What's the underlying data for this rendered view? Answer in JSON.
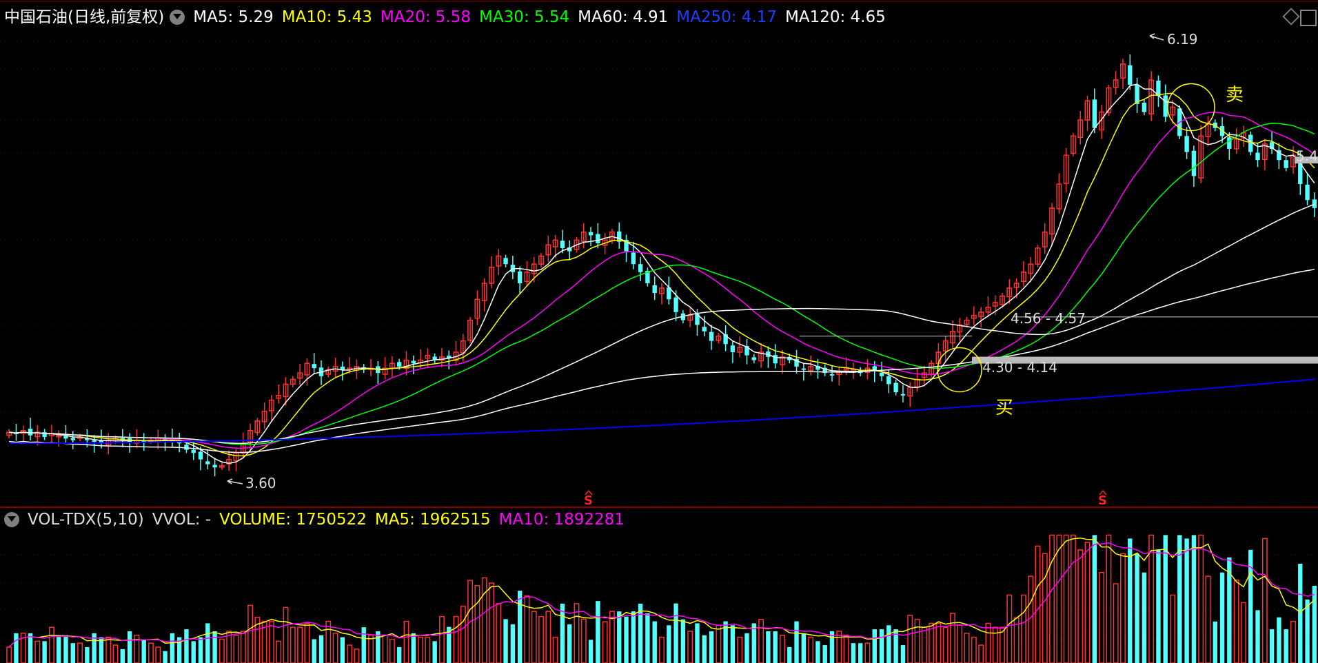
{
  "header": {
    "title": "中国石油(日线,前复权)",
    "ma": [
      {
        "label": "MA5: 5.29",
        "color": "#ffffff"
      },
      {
        "label": "MA10: 5.43",
        "color": "#ffff00"
      },
      {
        "label": "MA20: 5.58",
        "color": "#ff00ff"
      },
      {
        "label": "MA30: 5.54",
        "color": "#00ff00"
      },
      {
        "label": "MA60: 4.91",
        "color": "#ffffff"
      },
      {
        "label": "MA250: 4.17",
        "color": "#0000ff"
      },
      {
        "label": "MA120: 4.65",
        "color": "#ffffff"
      }
    ]
  },
  "volume_header": {
    "title": "VOL-TDX(5,10)",
    "vvol": "VVOL: -",
    "volume": "VOLUME: 1750522",
    "ma5": "MA5: 1962515",
    "ma10": "MA10: 1892281"
  },
  "annotations": {
    "high": "6.19",
    "low": "3.60",
    "buy": "买",
    "sell": "卖",
    "range_upper": "4.56 - 4.57",
    "range_lower": "4.30 - 4.14",
    "right_edge_label": "5.4",
    "s_marker": "S"
  },
  "colors": {
    "up": "#ff3232",
    "down": "#54ffff",
    "ma5": "#ffffff",
    "ma10": "#ffff00",
    "ma20": "#ff00ff",
    "ma30": "#00ff00",
    "ma60": "#ffffff",
    "ma120": "#ffffff",
    "ma250": "#0000ff",
    "grid": "#3a0000"
  },
  "chart_data": {
    "type": "candlestick",
    "title": "中国石油(日线,前复权)",
    "price_ylim": [
      3.45,
      6.3
    ],
    "high": 6.19,
    "low": 3.6,
    "close_series": [
      3.85,
      3.84,
      3.86,
      3.83,
      3.85,
      3.82,
      3.84,
      3.83,
      3.81,
      3.8,
      3.82,
      3.8,
      3.79,
      3.78,
      3.8,
      3.81,
      3.8,
      3.79,
      3.8,
      3.79,
      3.8,
      3.81,
      3.8,
      3.79,
      3.78,
      3.74,
      3.72,
      3.68,
      3.65,
      3.63,
      3.64,
      3.68,
      3.72,
      3.78,
      3.86,
      3.92,
      3.98,
      4.05,
      4.08,
      4.15,
      4.18,
      4.22,
      4.28,
      4.25,
      4.2,
      4.24,
      4.26,
      4.24,
      4.25,
      4.26,
      4.24,
      4.25,
      4.22,
      4.25,
      4.28,
      4.26,
      4.3,
      4.28,
      4.3,
      4.33,
      4.3,
      4.32,
      4.31,
      4.35,
      4.42,
      4.55,
      4.68,
      4.78,
      4.88,
      4.95,
      4.9,
      4.85,
      4.78,
      4.85,
      4.9,
      4.95,
      5.02,
      5.05,
      5.0,
      4.98,
      5.05,
      5.1,
      5.08,
      5.03,
      5.05,
      5.1,
      5.04,
      4.98,
      4.9,
      4.85,
      4.78,
      4.72,
      4.75,
      4.68,
      4.6,
      4.55,
      4.58,
      4.52,
      4.48,
      4.42,
      4.45,
      4.4,
      4.35,
      4.38,
      4.33,
      4.3,
      4.35,
      4.32,
      4.28,
      4.32,
      4.3,
      4.26,
      4.24,
      4.26,
      4.24,
      4.22,
      4.21,
      4.23,
      4.25,
      4.24,
      4.22,
      4.25,
      4.23,
      4.2,
      4.15,
      4.1,
      4.08,
      4.13,
      4.18,
      4.22,
      4.28,
      4.35,
      4.42,
      4.48,
      4.52,
      4.55,
      4.58,
      4.6,
      4.63,
      4.66,
      4.7,
      4.75,
      4.78,
      4.85,
      4.9,
      5.0,
      5.1,
      5.25,
      5.4,
      5.58,
      5.7,
      5.8,
      5.92,
      5.75,
      5.85,
      6.0,
      6.05,
      6.15,
      6.02,
      5.9,
      5.85,
      6.05,
      5.95,
      5.82,
      5.88,
      5.7,
      5.6,
      5.45,
      5.7,
      5.78,
      5.75,
      5.7,
      5.62,
      5.68,
      5.72,
      5.6,
      5.55,
      5.65,
      5.62,
      5.55,
      5.5,
      5.58,
      5.4,
      5.3,
      5.25
    ],
    "volume_ylim": [
      0,
      3000000
    ],
    "volume": 1750522,
    "volume_ma5": 1962515,
    "volume_ma10": 1892281,
    "moving_averages": {
      "MA5": 5.29,
      "MA10": 5.43,
      "MA20": 5.58,
      "MA30": 5.54,
      "MA60": 4.91,
      "MA250": 4.17,
      "MA120": 4.65
    },
    "grid": true
  }
}
